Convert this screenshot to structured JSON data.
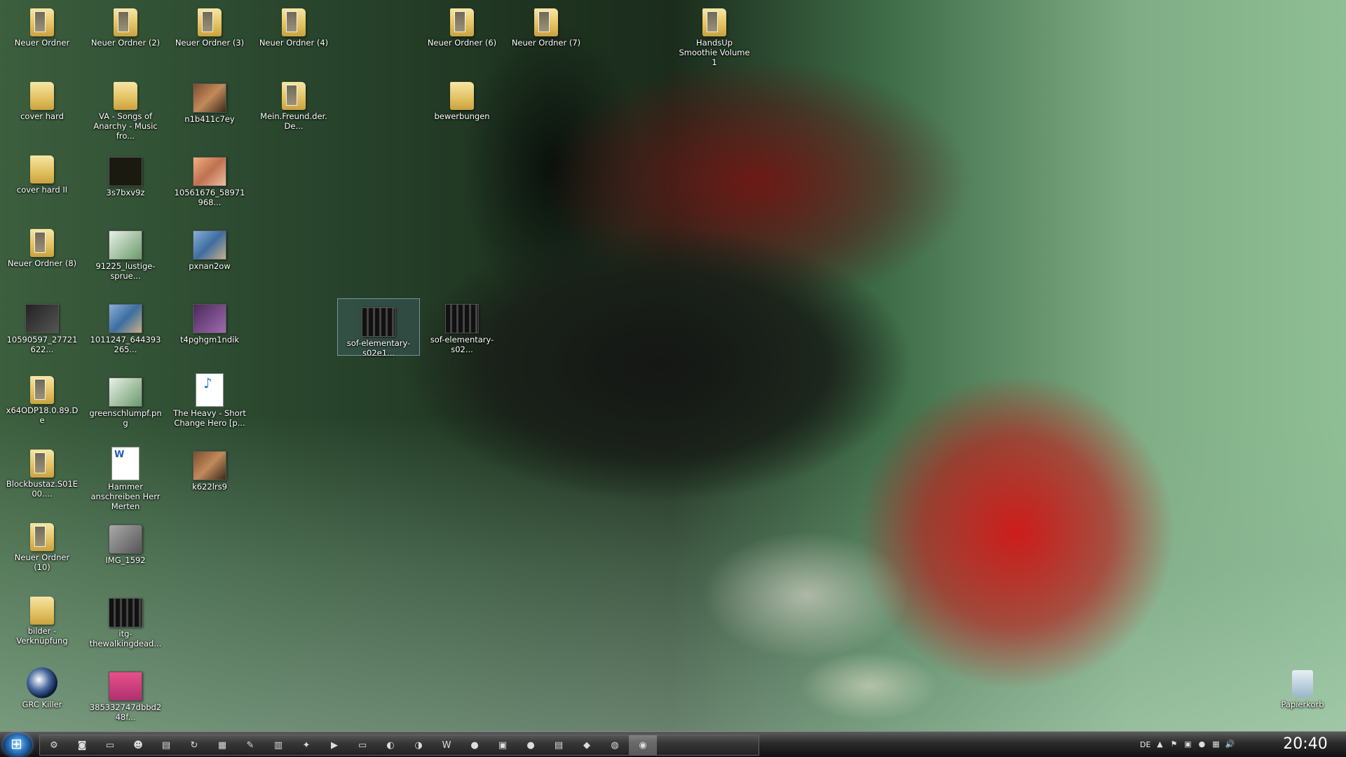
{
  "desktop": {
    "icons": [
      {
        "label": "Neuer Ordner"
      },
      {
        "label": "Neuer Ordner (2)"
      },
      {
        "label": "Neuer Ordner (3)"
      },
      {
        "label": "Neuer Ordner (4)"
      },
      {
        "label": "Neuer Ordner (6)"
      },
      {
        "label": "Neuer Ordner (7)"
      },
      {
        "label": "HandsUp Smoothie Volume 1"
      },
      {
        "label": "cover hard"
      },
      {
        "label": "VA - Songs of Anarchy - Music fro..."
      },
      {
        "label": "n1b411c7ey"
      },
      {
        "label": "Mein.Freund.der.De..."
      },
      {
        "label": "bewerbungen"
      },
      {
        "label": "cover hard II"
      },
      {
        "label": "3s7bxv9z"
      },
      {
        "label": "10561676_58971968..."
      },
      {
        "label": "Neuer Ordner (8)"
      },
      {
        "label": "91225_lustige-sprue..."
      },
      {
        "label": "pxnan2ow"
      },
      {
        "label": "10590597_27721622..."
      },
      {
        "label": "1011247_644393265..."
      },
      {
        "label": "t4pghgm1ndik"
      },
      {
        "label": "sof-elementary-s02e1..."
      },
      {
        "label": "sof-elementary-s02..."
      },
      {
        "label": "x64ODP18.0.89.De"
      },
      {
        "label": "greenschlumpf.png"
      },
      {
        "label": "The Heavy - Short Change Hero [p..."
      },
      {
        "label": "Blockbustaz.S01E00...."
      },
      {
        "label": "Hammer anschreiben Herr Merten"
      },
      {
        "label": "k622lrs9"
      },
      {
        "label": "Neuer Ordner (10)"
      },
      {
        "label": "IMG_1592"
      },
      {
        "label": "bilder - Verknüpfung"
      },
      {
        "label": "itg-thewalkingdead..."
      },
      {
        "label": "GRC Killer"
      },
      {
        "label": "385332747dbbd248f..."
      },
      {
        "label": "Papierkorb"
      }
    ]
  },
  "taskbar": {
    "start_label": "Start",
    "quicklaunch": [
      "⚙",
      "◙",
      "▭",
      "☻",
      "▤",
      "↻",
      "▦",
      "✎",
      "▥",
      "✦",
      "▶",
      "▭",
      "◐",
      "◑",
      "W",
      "●",
      "▣",
      "●",
      "▤",
      "◆",
      "◍",
      "◉"
    ],
    "tray": {
      "language": "DE",
      "arrow": "▲",
      "icons": [
        "⚑",
        "▣",
        "●",
        "▦",
        "🔊"
      ]
    },
    "clock": "20:40"
  },
  "colors": {
    "taskbar_top": "#5b5b5b",
    "taskbar_bottom": "#111111",
    "label_text": "#ffffff"
  }
}
